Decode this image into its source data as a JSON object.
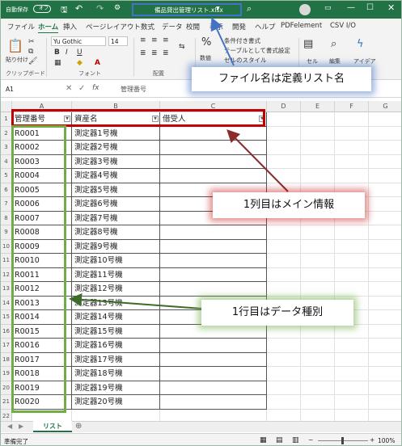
{
  "titlebar": {
    "autosave_label": "自動保存",
    "autosave_state": "オフ",
    "filename": "備品貸出管理リスト.xlsx"
  },
  "tabs": [
    "ファイル",
    "ホーム",
    "挿入",
    "ページレイアウト",
    "数式",
    "データ",
    "校閲",
    "表示",
    "開発",
    "ヘルプ",
    "PDFelement",
    "CSV I/O"
  ],
  "ribbon": {
    "paste": "貼り付け",
    "clipboard": "クリップボード",
    "font_name": "Yu Gothic",
    "font_size": "14",
    "font_group": "フォント",
    "align_group": "配置",
    "number_label": "数値",
    "cond_format": "条件付き書式",
    "table_format": "テーブルとして書式設定",
    "cell_style": "セルのスタイル",
    "cell_label": "セル",
    "edit_label": "編集",
    "idea_label": "アイデア"
  },
  "formula_bar": {
    "name_box": "A1",
    "fx": "fx",
    "content": "管理番号"
  },
  "columns": [
    "A",
    "B",
    "C",
    "D",
    "E",
    "F",
    "G"
  ],
  "headers": [
    "管理番号",
    "資産名",
    "借受人"
  ],
  "rows": [
    [
      "R0001",
      "測定器1号機"
    ],
    [
      "R0002",
      "測定器2号機"
    ],
    [
      "R0003",
      "測定器3号機"
    ],
    [
      "R0004",
      "測定器4号機"
    ],
    [
      "R0005",
      "測定器5号機"
    ],
    [
      "R0006",
      "測定器6号機"
    ],
    [
      "R0007",
      "測定器7号機"
    ],
    [
      "R0008",
      "測定器8号機"
    ],
    [
      "R0009",
      "測定器9号機"
    ],
    [
      "R0010",
      "測定器10号機"
    ],
    [
      "R0011",
      "測定器11号機"
    ],
    [
      "R0012",
      "測定器12号機"
    ],
    [
      "R0013",
      "測定器13号機"
    ],
    [
      "R0014",
      "測定器14号機"
    ],
    [
      "R0015",
      "測定器15号機"
    ],
    [
      "R0016",
      "測定器16号機"
    ],
    [
      "R0017",
      "測定器17号機"
    ],
    [
      "R0018",
      "測定器18号機"
    ],
    [
      "R0019",
      "測定器19号機"
    ],
    [
      "R0020",
      "測定器20号機"
    ]
  ],
  "row_numbers": [
    "1",
    "2",
    "3",
    "4",
    "5",
    "6",
    "7",
    "8",
    "9",
    "10",
    "11",
    "12",
    "13",
    "14",
    "15",
    "16",
    "17",
    "18",
    "19",
    "20",
    "21",
    "22"
  ],
  "sheet_tab": "リスト",
  "status": {
    "ready": "準備完了",
    "zoom": "100%"
  },
  "callouts": {
    "filename_note": "ファイル名は定義リスト名",
    "row1_note": "1列目はメイン情報",
    "col1_note": "1行目はデータ種別"
  },
  "colors": {
    "excel_green": "#217346",
    "annotation_red": "#c00000",
    "annotation_green": "#70ad47",
    "title_box": "#4472c4"
  }
}
